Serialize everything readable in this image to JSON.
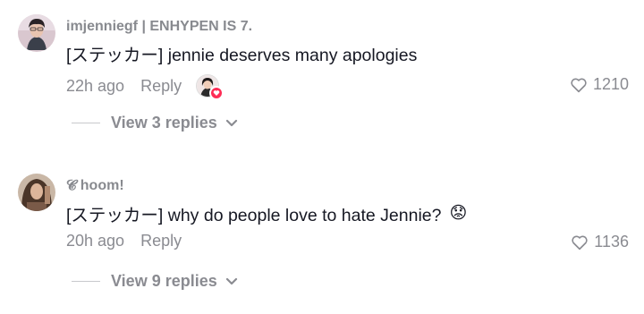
{
  "comments": [
    {
      "username": "imjenniegf | ENHYPEN IS 7.",
      "text": "[ステッカー] jennie deserves many apologies",
      "time": "22h ago",
      "reply_label": "Reply",
      "likes": "1210",
      "view_replies": "View 3 replies",
      "liked_by_creator": true,
      "emoji": ""
    },
    {
      "username": "𝓒 hoom!",
      "text": "[ステッカー] why do people love to hate Jennie?",
      "time": "20h ago",
      "reply_label": "Reply",
      "likes": "1136",
      "view_replies": "View 9 replies",
      "liked_by_creator": false,
      "emoji": "😟"
    }
  ],
  "icons": {
    "like": "heart-outline-icon",
    "expand": "chevron-down-icon",
    "creator_badge": "heart-badge-icon"
  },
  "colors": {
    "primary_text": "#161823",
    "secondary_text": "#8a8b91",
    "accent": "#fe2c55"
  }
}
